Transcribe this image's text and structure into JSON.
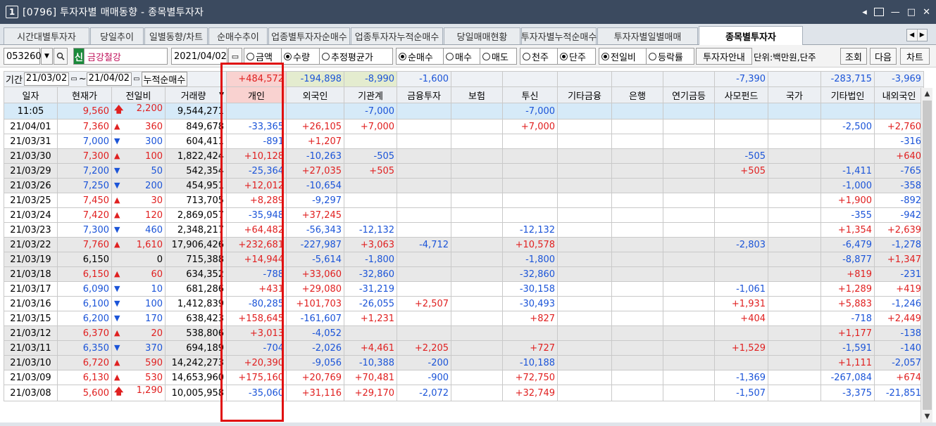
{
  "window": {
    "num": "1",
    "title": "[0796] 투자자별 매매동향 - 종목별투자자"
  },
  "tabs": [
    "시간대별투자자",
    "당일추이",
    "일별동향/차트",
    "순매수추이",
    "업종별투자자순매수",
    "업종투자자누적순매수",
    "당일매매현황",
    "투자자별누적순매수",
    "투자자별일별매매",
    "종목별투자자"
  ],
  "active_tab": 9,
  "toolbar": {
    "code": "053260",
    "badge": "신",
    "stock_name": "금강철강",
    "date": "2021/04/02",
    "radio_amount": "금액",
    "radio_qty": "수량",
    "radio_avg": "추정평균가",
    "radio_net": "순매수",
    "radio_buy": "매수",
    "radio_sell": "매도",
    "radio_thousand": "천주",
    "radio_unit": "단주",
    "radio_prev": "전일비",
    "radio_rate": "등락률",
    "investor_btn": "투자자안내",
    "unit_label": "단위:백만원,단주",
    "search_btn": "조회",
    "next_btn": "다음",
    "chart_btn": "차트"
  },
  "period": {
    "label": "기간",
    "from": "21/03/02",
    "to": "21/04/02",
    "cum_label": "누적순매수"
  },
  "sums": [
    "+484,572",
    "-194,898",
    "-8,990",
    "-1,600",
    "",
    "",
    "",
    "",
    "",
    "-7,390",
    "",
    "-283,715",
    "-3,969"
  ],
  "headers": [
    "일자",
    "현재가",
    "전일비",
    "거래량",
    "개인",
    "외국인",
    "기관계",
    "금융투자",
    "보험",
    "투신",
    "기타금융",
    "은행",
    "연기금등",
    "사모펀드",
    "국가",
    "기타법인",
    "내외국인"
  ],
  "rows": [
    {
      "date": "11:05",
      "price": "9,560",
      "dir": "uparrow",
      "chg": "2,200",
      "vol": "9,544,271",
      "vals": [
        "",
        "",
        "-7,000",
        "",
        "",
        "-7,000",
        "",
        "",
        "",
        "",
        "",
        "",
        ""
      ],
      "style": "cur"
    },
    {
      "date": "21/04/01",
      "price": "7,360",
      "dir": "up",
      "chg": "360",
      "vol": "849,678",
      "vals": [
        "-33,365",
        "+26,105",
        "+7,000",
        "",
        "",
        "+7,000",
        "",
        "",
        "",
        "",
        "",
        "-2,500",
        "+2,760"
      ],
      "style": ""
    },
    {
      "date": "21/03/31",
      "price": "7,000",
      "dir": "down",
      "chg": "300",
      "vol": "604,411",
      "vals": [
        "-891",
        "+1,207",
        "",
        "",
        "",
        "",
        "",
        "",
        "",
        "",
        "",
        "",
        "-316"
      ],
      "style": ""
    },
    {
      "date": "21/03/30",
      "price": "7,300",
      "dir": "up",
      "chg": "100",
      "vol": "1,822,424",
      "vals": [
        "+10,128",
        "-10,263",
        "-505",
        "",
        "",
        "",
        "",
        "",
        "",
        "-505",
        "",
        "",
        "+640"
      ],
      "style": "alt"
    },
    {
      "date": "21/03/29",
      "price": "7,200",
      "dir": "down",
      "chg": "50",
      "vol": "542,354",
      "vals": [
        "-25,364",
        "+27,035",
        "+505",
        "",
        "",
        "",
        "",
        "",
        "",
        "+505",
        "",
        "-1,411",
        "-765"
      ],
      "style": "alt"
    },
    {
      "date": "21/03/26",
      "price": "7,250",
      "dir": "down",
      "chg": "200",
      "vol": "454,951",
      "vals": [
        "+12,012",
        "-10,654",
        "",
        "",
        "",
        "",
        "",
        "",
        "",
        "",
        "",
        "-1,000",
        "-358"
      ],
      "style": "alt"
    },
    {
      "date": "21/03/25",
      "price": "7,450",
      "dir": "up",
      "chg": "30",
      "vol": "713,705",
      "vals": [
        "+8,289",
        "-9,297",
        "",
        "",
        "",
        "",
        "",
        "",
        "",
        "",
        "",
        "+1,900",
        "-892"
      ],
      "style": ""
    },
    {
      "date": "21/03/24",
      "price": "7,420",
      "dir": "up",
      "chg": "120",
      "vol": "2,869,057",
      "vals": [
        "-35,948",
        "+37,245",
        "",
        "",
        "",
        "",
        "",
        "",
        "",
        "",
        "",
        "-355",
        "-942"
      ],
      "style": ""
    },
    {
      "date": "21/03/23",
      "price": "7,300",
      "dir": "down",
      "chg": "460",
      "vol": "2,348,217",
      "vals": [
        "+64,482",
        "-56,343",
        "-12,132",
        "",
        "",
        "-12,132",
        "",
        "",
        "",
        "",
        "",
        "+1,354",
        "+2,639"
      ],
      "style": ""
    },
    {
      "date": "21/03/22",
      "price": "7,760",
      "dir": "up",
      "chg": "1,610",
      "vol": "17,906,426",
      "vals": [
        "+232,681",
        "-227,987",
        "+3,063",
        "-4,712",
        "",
        "+10,578",
        "",
        "",
        "",
        "-2,803",
        "",
        "-6,479",
        "-1,278"
      ],
      "style": "alt"
    },
    {
      "date": "21/03/19",
      "price": "6,150",
      "dir": "none",
      "chg": "0",
      "vol": "715,388",
      "vals": [
        "+14,944",
        "-5,614",
        "-1,800",
        "",
        "",
        "-1,800",
        "",
        "",
        "",
        "",
        "",
        "-8,877",
        "+1,347"
      ],
      "style": "alt"
    },
    {
      "date": "21/03/18",
      "price": "6,150",
      "dir": "up",
      "chg": "60",
      "vol": "634,352",
      "vals": [
        "-788",
        "+33,060",
        "-32,860",
        "",
        "",
        "-32,860",
        "",
        "",
        "",
        "",
        "",
        "+819",
        "-231"
      ],
      "style": "alt"
    },
    {
      "date": "21/03/17",
      "price": "6,090",
      "dir": "down",
      "chg": "10",
      "vol": "681,286",
      "vals": [
        "+431",
        "+29,080",
        "-31,219",
        "",
        "",
        "-30,158",
        "",
        "",
        "",
        "-1,061",
        "",
        "+1,289",
        "+419"
      ],
      "style": ""
    },
    {
      "date": "21/03/16",
      "price": "6,100",
      "dir": "down",
      "chg": "100",
      "vol": "1,412,839",
      "vals": [
        "-80,285",
        "+101,703",
        "-26,055",
        "+2,507",
        "",
        "-30,493",
        "",
        "",
        "",
        "+1,931",
        "",
        "+5,883",
        "-1,246"
      ],
      "style": ""
    },
    {
      "date": "21/03/15",
      "price": "6,200",
      "dir": "down",
      "chg": "170",
      "vol": "638,423",
      "vals": [
        "+158,645",
        "-161,607",
        "+1,231",
        "",
        "",
        "+827",
        "",
        "",
        "",
        "+404",
        "",
        "-718",
        "+2,449"
      ],
      "style": ""
    },
    {
      "date": "21/03/12",
      "price": "6,370",
      "dir": "up",
      "chg": "20",
      "vol": "538,806",
      "vals": [
        "+3,013",
        "-4,052",
        "",
        "",
        "",
        "",
        "",
        "",
        "",
        "",
        "",
        "+1,177",
        "-138"
      ],
      "style": "alt"
    },
    {
      "date": "21/03/11",
      "price": "6,350",
      "dir": "down",
      "chg": "370",
      "vol": "694,189",
      "vals": [
        "-704",
        "-2,026",
        "+4,461",
        "+2,205",
        "",
        "+727",
        "",
        "",
        "",
        "+1,529",
        "",
        "-1,591",
        "-140"
      ],
      "style": "alt"
    },
    {
      "date": "21/03/10",
      "price": "6,720",
      "dir": "up",
      "chg": "590",
      "vol": "14,242,273",
      "vals": [
        "+20,390",
        "-9,056",
        "-10,388",
        "-200",
        "",
        "-10,188",
        "",
        "",
        "",
        "",
        "",
        "+1,111",
        "-2,057"
      ],
      "style": "alt"
    },
    {
      "date": "21/03/09",
      "price": "6,130",
      "dir": "up",
      "chg": "530",
      "vol": "14,653,960",
      "vals": [
        "+175,160",
        "+20,769",
        "+70,481",
        "-900",
        "",
        "+72,750",
        "",
        "",
        "",
        "-1,369",
        "",
        "-267,084",
        "+674"
      ],
      "style": ""
    },
    {
      "date": "21/03/08",
      "price": "5,600",
      "dir": "uparrow",
      "chg": "1,290",
      "vol": "10,005,958",
      "vals": [
        "-35,060",
        "+31,116",
        "+29,170",
        "-2,072",
        "",
        "+32,749",
        "",
        "",
        "",
        "-1,507",
        "",
        "-3,375",
        "-21,851"
      ],
      "style": ""
    }
  ],
  "colors": {
    "up": "#e02020",
    "down": "#1b54d8",
    "highlight_border": "#e01010",
    "titlebar": "#3b4a5f"
  }
}
